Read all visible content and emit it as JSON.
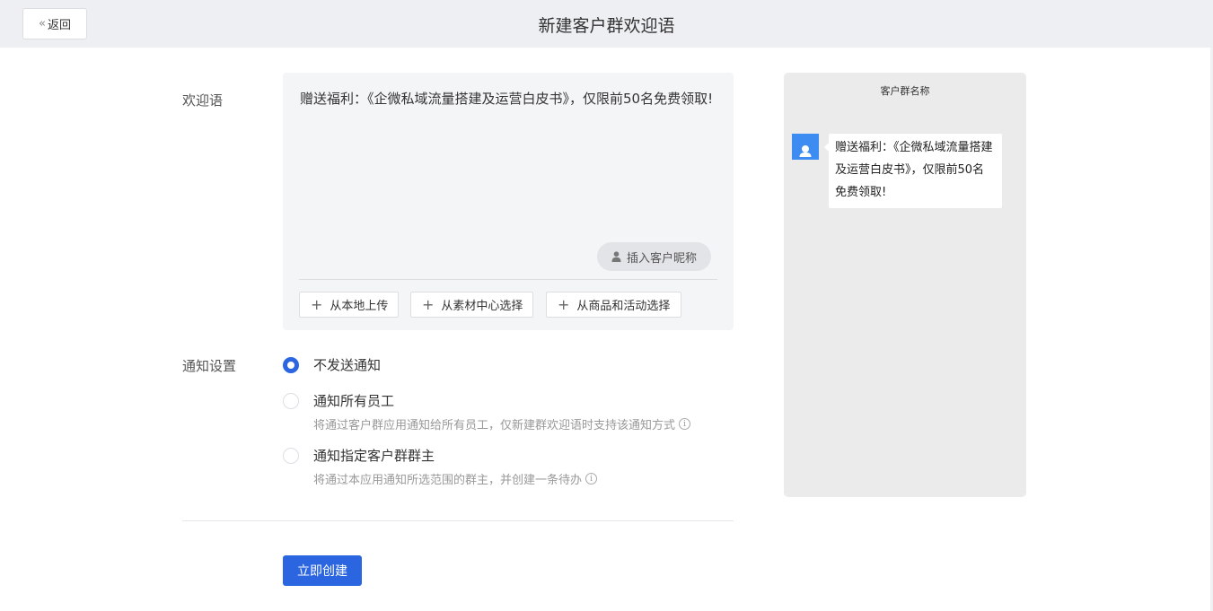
{
  "header": {
    "back_label": "返回",
    "title": "新建客户群欢迎语"
  },
  "welcome": {
    "label": "欢迎语",
    "text": "赠送福利：《企微私域流量搭建及运营白皮书》，仅限前50名免费领取!",
    "insert_nickname": "插入客户昵称",
    "upload_buttons": [
      "从本地上传",
      "从素材中心选择",
      "从商品和活动选择"
    ]
  },
  "notify": {
    "label": "通知设置",
    "options": [
      {
        "label": "不发送通知",
        "checked": true,
        "desc": ""
      },
      {
        "label": "通知所有员工",
        "checked": false,
        "desc": "将通过客户群应用通知给所有员工，仅新建群欢迎语时支持该通知方式"
      },
      {
        "label": "通知指定客户群群主",
        "checked": false,
        "desc": "将通过本应用通知所选范围的群主，并创建一条待办"
      }
    ]
  },
  "actions": {
    "create_label": "立即创建"
  },
  "preview": {
    "group_name": "客户群名称",
    "message": "赠送福利：《企微私域流量搭建及运营白皮书》，仅限前50名免费领取!"
  },
  "colors": {
    "primary": "#2b66e0",
    "avatar": "#3d8cf2",
    "preview_bg": "#ebebeb"
  },
  "icons": {
    "back": "double-chevron-left-icon",
    "person": "person-icon",
    "plus": "plus-icon",
    "info": "info-icon"
  }
}
